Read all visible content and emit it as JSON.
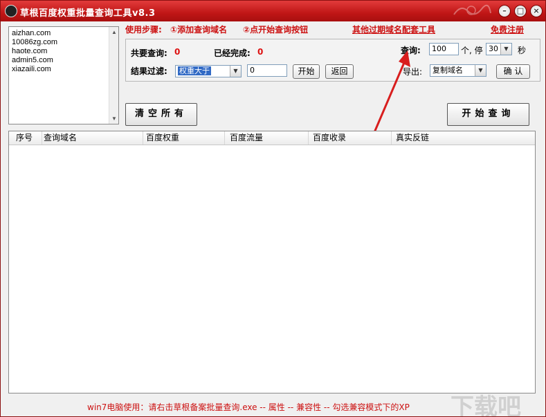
{
  "window": {
    "title": "草根百度权重批量查询工具v8.3"
  },
  "title_buttons": {
    "minimize": "–",
    "restore": "□",
    "close": "×"
  },
  "domains": [
    "aizhan.com",
    "10086zg.com",
    "haote.com",
    "admin5.com",
    "xiazaili.com"
  ],
  "steps": {
    "prefix": "使用步骤:",
    "step1": "①添加查询域名",
    "step2": "②点开始查询按钮"
  },
  "links": {
    "other_tools": "其他过期域名配套工具",
    "register": "免费注册"
  },
  "stats": {
    "total_label": "共要查询:",
    "total_value": "0",
    "done_label": "已经完成:",
    "done_value": "0"
  },
  "query": {
    "label": "查询:",
    "count": "100",
    "unit_stop": "个, 停",
    "seconds": "30",
    "unit_sec": "秒"
  },
  "filter": {
    "label": "结果过滤:",
    "option": "权重大于",
    "value": "0",
    "start_btn": "开始",
    "back_btn": "返回"
  },
  "export": {
    "label": "导出:",
    "option": "复制域名",
    "confirm_btn": "确 认"
  },
  "buttons": {
    "clear_all": "清空所有",
    "start_query": "开始查询"
  },
  "table": {
    "columns": [
      "序号",
      "查询域名",
      "百度权重",
      "百度流量",
      "百度收录",
      "真实反链"
    ]
  },
  "footer": "win7电脑使用：请右击草根备案批量查询.exe -- 属性 -- 兼容性 -- 勾选兼容模式下的XP",
  "watermark": "下载吧",
  "colors": {
    "title_bar": "#c01616",
    "accent_text": "#cc1111"
  }
}
